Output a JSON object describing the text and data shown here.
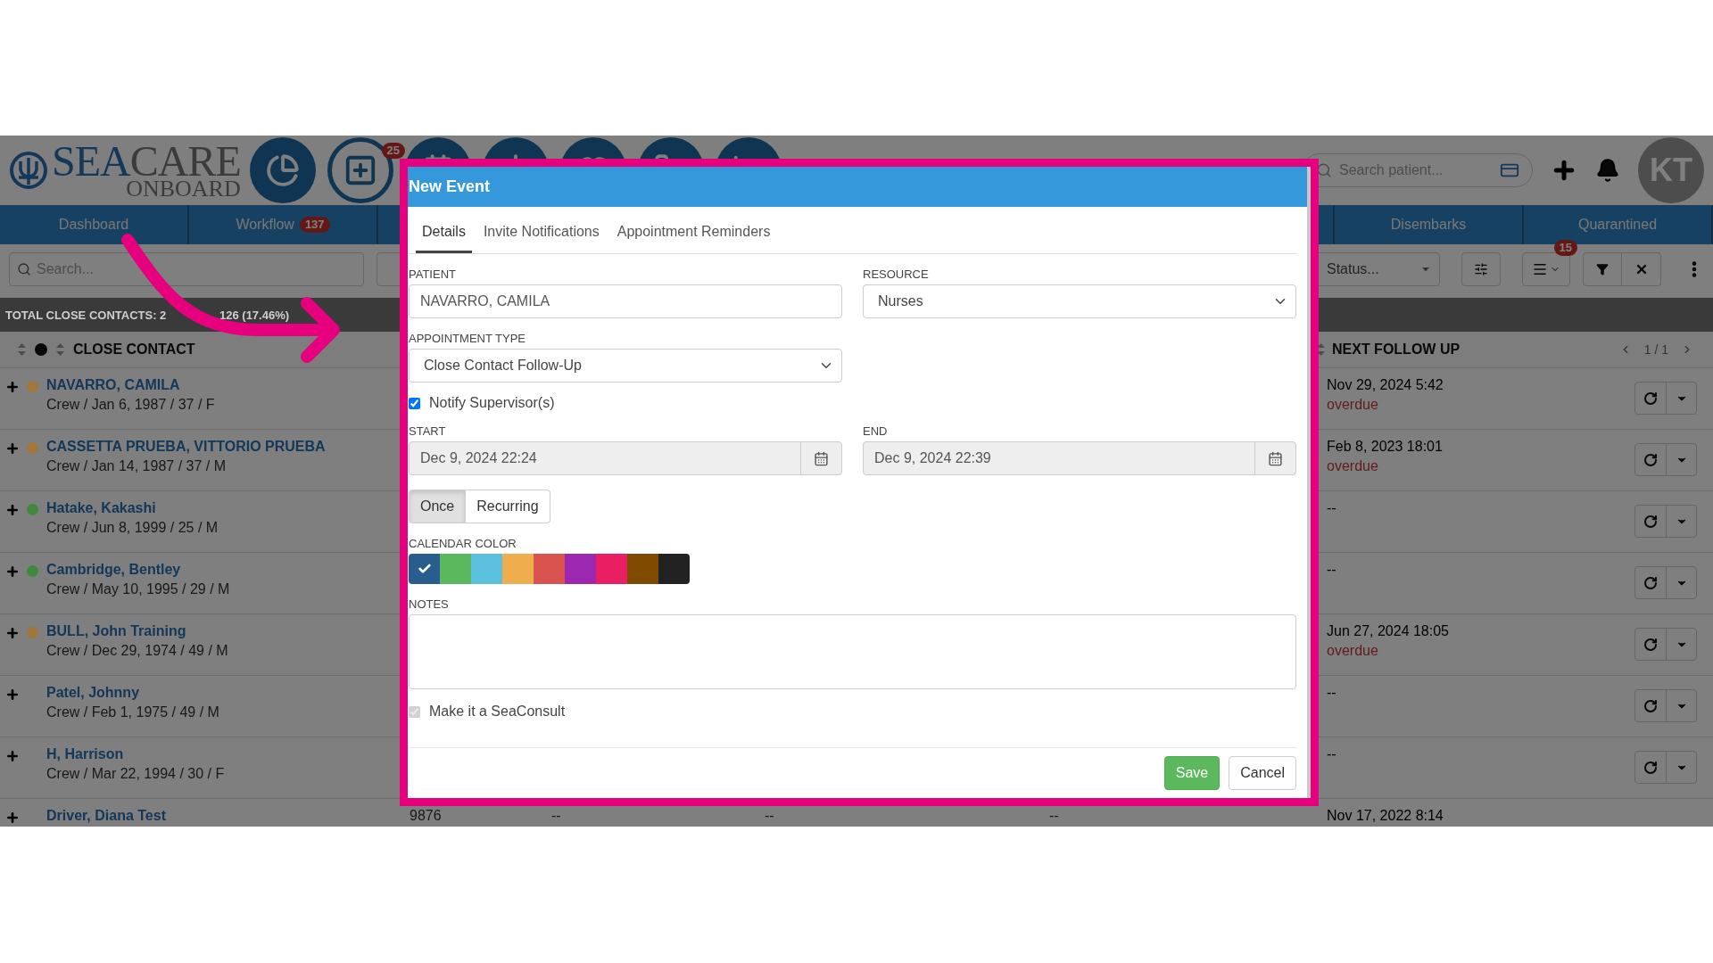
{
  "header": {
    "logo": {
      "primary": "SEA",
      "secondary": "CARE",
      "tagline": "ONBOARD"
    },
    "notification_badge": "25",
    "search": {
      "placeholder": "Search patient..."
    },
    "avatar": "KT"
  },
  "nav_tabs_left": [
    {
      "label": "Dashboard"
    },
    {
      "label": "Workflow",
      "badge": "137"
    }
  ],
  "nav_tabs_right": [
    {
      "label": "Disembarks"
    },
    {
      "label": "Quarantined"
    }
  ],
  "toolbar": {
    "search": {
      "placeholder": "Search..."
    },
    "status_select": {
      "placeholder": "Status..."
    },
    "list_badge": "15"
  },
  "summary": [
    "TOTAL CLOSE CONTACTS: 2",
    "126 (17.46%)"
  ],
  "table": {
    "columns": [
      {
        "label": "CLOSE CONTACT"
      },
      {
        "label": "NEXT FOLLOW UP"
      }
    ],
    "pagination": "1 / 1",
    "rows": [
      {
        "name": "NAVARRO, CAMILA",
        "details": "Crew / Jan 6, 1987 / 37 / F",
        "color": "#a0763a",
        "next_follow_up": "Nov 29, 2024 5:42",
        "status": "overdue"
      },
      {
        "name": "CASSETTA PRUEBA, VITTORIO PRUEBA",
        "details": "Crew / Jan 14, 1987 / 37 / M",
        "color": "#a0763a",
        "next_follow_up": "Feb 8, 2023 18:01",
        "status": "overdue"
      },
      {
        "name": "Hatake, Kakashi",
        "details": "Crew / Jun 8, 1999 / 25 / M",
        "color": "#3f8a3f",
        "next_follow_up": "--"
      },
      {
        "name": "Cambridge, Bentley",
        "details": "Crew / May 10, 1995 / 29 / M",
        "color": "#3f8a3f",
        "next_follow_up": "--"
      },
      {
        "name": "BULL, John Training",
        "details": "Crew / Dec 29, 1974 / 49 / M",
        "color": "#a0763a",
        "next_follow_up": "Jun 27, 2024 18:05",
        "status": "overdue"
      },
      {
        "name": "Patel, Johnny",
        "details": "Crew / Feb 1, 1975 / 49 / M",
        "next_follow_up": "--"
      },
      {
        "name": "H, Harrison",
        "details": "Crew / Mar 22, 1994 / 30 / F",
        "next_follow_up": "--"
      },
      {
        "name": "Driver, Diana Test",
        "cells": [
          "9876",
          "--",
          "--",
          "--"
        ],
        "next_follow_up": "Nov 17, 2022 8:14"
      }
    ]
  },
  "modal": {
    "title": "New Event",
    "tabs": [
      {
        "label": "Details",
        "selected": true
      },
      {
        "label": "Invite Notifications",
        "selected": false
      },
      {
        "label": "Appointment Reminders",
        "selected": false
      }
    ],
    "patient": {
      "label": "PATIENT",
      "value": "NAVARRO, CAMILA"
    },
    "resource": {
      "label": "RESOURCE",
      "value": "Nurses"
    },
    "appointment_type": {
      "label": "APPOINTMENT TYPE",
      "value": "Close Contact Follow-Up"
    },
    "notify": {
      "label": "Notify Supervisor(s)",
      "checked": true
    },
    "start": {
      "label": "START",
      "value": "Dec 9, 2024 22:24"
    },
    "end": {
      "label": "END",
      "value": "Dec 9, 2024 22:39"
    },
    "frequency": [
      {
        "label": "Once",
        "selected": true
      },
      {
        "label": "Recurring",
        "selected": false
      }
    ],
    "calendar_color": {
      "label": "CALENDAR COLOR",
      "swatches": [
        {
          "color": "#2a5d8f",
          "selected": true
        },
        {
          "color": "#5cb85c",
          "selected": false
        },
        {
          "color": "#5bc0de",
          "selected": false
        },
        {
          "color": "#f0ad4e",
          "selected": false
        },
        {
          "color": "#d9534f",
          "selected": false
        },
        {
          "color": "#9c27b0",
          "selected": false
        },
        {
          "color": "#e91e63",
          "selected": false
        },
        {
          "color": "#804a00",
          "selected": false
        },
        {
          "color": "#222222",
          "selected": false
        }
      ]
    },
    "notes": {
      "label": "NOTES"
    },
    "seaconsult": {
      "label": "Make it a SeaConsult",
      "checked": true,
      "disabled": true
    },
    "buttons": [
      {
        "label": "Save",
        "kind": "primary"
      },
      {
        "label": "Cancel",
        "kind": "default"
      }
    ]
  }
}
